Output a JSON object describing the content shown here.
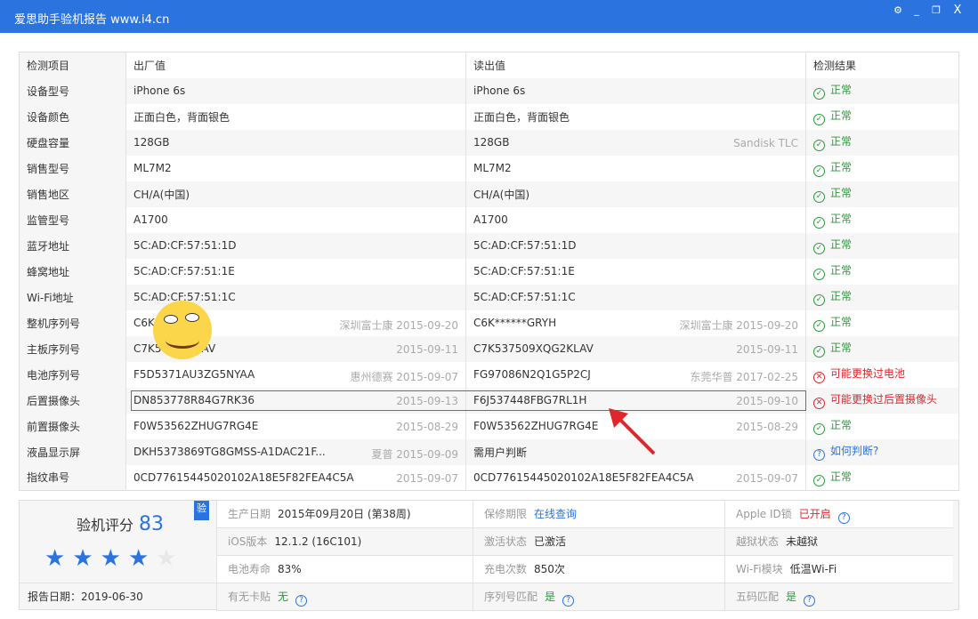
{
  "window": {
    "title": "爱思助手验机报告 www.i4.cn"
  },
  "table": {
    "headers": [
      "检测项目",
      "出厂值",
      "读出值",
      "检测结果"
    ],
    "rows": [
      {
        "item": "设备型号",
        "factory": "iPhone 6s",
        "factory_sub": "",
        "read": "iPhone 6s",
        "read_sub": "",
        "result": "正常",
        "status": "ok"
      },
      {
        "item": "设备颜色",
        "factory": "正面白色，背面银色",
        "factory_sub": "",
        "read": "正面白色，背面银色",
        "read_sub": "",
        "result": "正常",
        "status": "ok"
      },
      {
        "item": "硬盘容量",
        "factory": "128GB",
        "factory_sub": "",
        "read": "128GB",
        "read_sub": "Sandisk TLC",
        "result": "正常",
        "status": "ok"
      },
      {
        "item": "销售型号",
        "factory": "ML7M2",
        "factory_sub": "",
        "read": "ML7M2",
        "read_sub": "",
        "result": "正常",
        "status": "ok"
      },
      {
        "item": "销售地区",
        "factory": "CH/A(中国)",
        "factory_sub": "",
        "read": "CH/A(中国)",
        "read_sub": "",
        "result": "正常",
        "status": "ok"
      },
      {
        "item": "监管型号",
        "factory": "A1700",
        "factory_sub": "",
        "read": "A1700",
        "read_sub": "",
        "result": "正常",
        "status": "ok"
      },
      {
        "item": "蓝牙地址",
        "factory": "5C:AD:CF:57:51:1D",
        "factory_sub": "",
        "read": "5C:AD:CF:57:51:1D",
        "read_sub": "",
        "result": "正常",
        "status": "ok"
      },
      {
        "item": "蜂窝地址",
        "factory": "5C:AD:CF:57:51:1E",
        "factory_sub": "",
        "read": "5C:AD:CF:57:51:1E",
        "read_sub": "",
        "result": "正常",
        "status": "ok"
      },
      {
        "item": "Wi-Fi地址",
        "factory": "5C:AD:CF:57:51:1C",
        "factory_sub": "",
        "read": "5C:AD:CF:57:51:1C",
        "read_sub": "",
        "result": "正常",
        "status": "ok"
      },
      {
        "item": "整机序列号",
        "factory": "C6K",
        "factory_sub": "深圳富士康 2015-09-20",
        "read": "C6K******GRYH",
        "read_sub": "深圳富士康 2015-09-20",
        "result": "正常",
        "status": "ok"
      },
      {
        "item": "主板序列号",
        "factory": "C7K5      QG2KLAV",
        "factory_sub": "2015-09-11",
        "read": "C7K537509XQG2KLAV",
        "read_sub": "2015-09-11",
        "result": "正常",
        "status": "ok"
      },
      {
        "item": "电池序列号",
        "factory": "F5D5371AU3ZG5NYAA",
        "factory_sub": "惠州德赛 2015-09-07",
        "read": "FG97086N2Q1G5P2CJ",
        "read_sub": "东莞华普 2017-02-25",
        "result": "可能更换过电池",
        "status": "bad"
      },
      {
        "item": "后置摄像头",
        "factory": "DN853778R84G7RK36",
        "factory_sub": "2015-09-13",
        "read": "F6J537448FBG7RL1H",
        "read_sub": "2015-09-10",
        "result": "可能更换过后置摄像头",
        "status": "bad"
      },
      {
        "item": "前置摄像头",
        "factory": "F0W53562ZHUG7RG4E",
        "factory_sub": "2015-08-29",
        "read": "F0W53562ZHUG7RG4E",
        "read_sub": "2015-08-29",
        "result": "正常",
        "status": "ok"
      },
      {
        "item": "液晶显示屏",
        "factory": "DKH5373869TG8GMSS-A1DAC21F...",
        "factory_sub": "夏普 2015-09-09",
        "read": "需用户判断",
        "read_sub": "",
        "result": "如何判断?",
        "status": "q"
      },
      {
        "item": "指纹串号",
        "factory": "0CD77615445020102A18E5F82FEA4C5A",
        "factory_sub": "2015-09-07",
        "read": "0CD77615445020102A18E5F82FEA4C5A",
        "read_sub": "2015-09-07",
        "result": "正常",
        "status": "ok"
      }
    ]
  },
  "summary": {
    "score_label": "验机评分",
    "score": "83",
    "stars": 4,
    "badge": "验",
    "report_date": "报告日期：2019-06-30",
    "cells": [
      {
        "k": "生产日期",
        "v": "2015年09月20日 (第38周)",
        "color": "#333",
        "help": false
      },
      {
        "k": "保修期限",
        "v": "在线查询",
        "color": "#2b74df",
        "help": false
      },
      {
        "k": "Apple ID锁",
        "v": "已开启",
        "color": "#e0262a",
        "help": true
      },
      {
        "k": "iOS版本",
        "v": "12.1.2 (16C101)",
        "color": "#333",
        "help": false
      },
      {
        "k": "激活状态",
        "v": "已激活",
        "color": "#333",
        "help": false
      },
      {
        "k": "越狱状态",
        "v": "未越狱",
        "color": "#333",
        "help": false
      },
      {
        "k": "电池寿命",
        "v": "83%",
        "color": "#333",
        "help": false
      },
      {
        "k": "充电次数",
        "v": "850次",
        "color": "#333",
        "help": false
      },
      {
        "k": "Wi-Fi模块",
        "v": "低温Wi-Fi",
        "color": "#333",
        "help": false
      },
      {
        "k": "有无卡贴",
        "v": "无",
        "color": "#2a9a3b",
        "help": true
      },
      {
        "k": "序列号匹配",
        "v": "是",
        "color": "#2a9a3b",
        "help": true
      },
      {
        "k": "五码匹配",
        "v": "是",
        "color": "#2a9a3b",
        "help": true
      }
    ]
  }
}
